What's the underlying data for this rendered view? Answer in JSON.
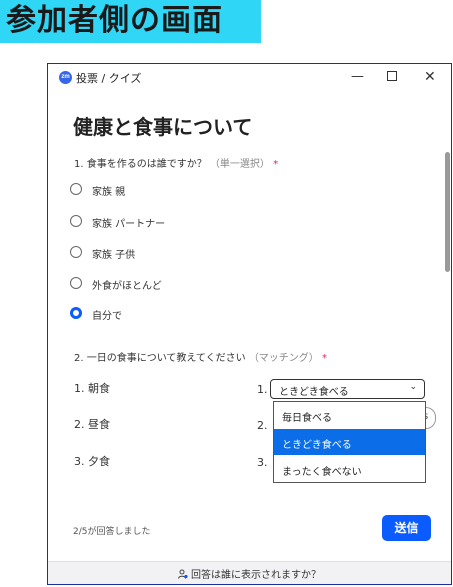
{
  "banner": {
    "text": "参加者側の画面"
  },
  "window": {
    "title": "投票 / クイズ",
    "logo_text": "zm",
    "controls": {
      "minimize": "—",
      "close": "✕"
    }
  },
  "poll": {
    "heading": "健康と食事について",
    "q1": {
      "label": "1. 食事を作るのは誰ですか？",
      "hint": "（単一選択）",
      "required_mark": "*",
      "options": [
        {
          "label": "家族  親",
          "checked": false
        },
        {
          "label": "家族  パートナー",
          "checked": false
        },
        {
          "label": "家族  子供",
          "checked": false
        },
        {
          "label": "外食がほとんど",
          "checked": false
        },
        {
          "label": "自分で",
          "checked": true
        }
      ]
    },
    "q2": {
      "label": "2. 一日の食事について教えてください",
      "hint": "（マッチング）",
      "required_mark": "*",
      "left_items": [
        "1. 朝食",
        "2. 昼食",
        "3. 夕食"
      ],
      "right_numbers": [
        "1.",
        "2.",
        "3."
      ],
      "selected_value": "ときどき食べる",
      "peek_text": "s",
      "menu_options": [
        {
          "label": "毎日食べる",
          "highlighted": false
        },
        {
          "label": "ときどき食べる",
          "highlighted": true
        },
        {
          "label": "まったく食べない",
          "highlighted": false
        }
      ]
    }
  },
  "status": {
    "answered": "2/5が回答しました"
  },
  "send_button": {
    "label": "送信"
  },
  "footer": {
    "text": "回答は誰に表示されますか？"
  },
  "colors": {
    "accent": "#0b5cff",
    "highlight": "#0b6ee8",
    "banner": "#2fd6f5",
    "frame": "#1b2fa5"
  }
}
